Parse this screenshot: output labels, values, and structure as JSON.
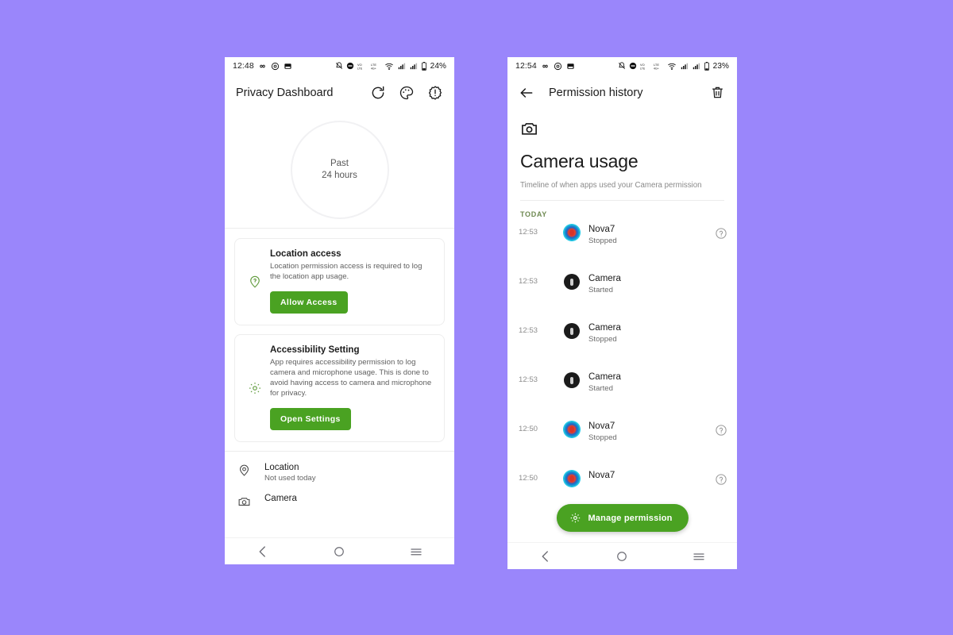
{
  "background_color": "#9a86fb",
  "accent_green": "#4aa222",
  "phones": {
    "left": {
      "status_bar": {
        "clock": "12:48",
        "battery_percent": "24%",
        "left_icons": [
          "infinity-icon",
          "at-circle-icon",
          "screenshot-icon"
        ],
        "right_icons": [
          "notifications-off-icon",
          "do-not-disturb-icon",
          "volte-icon",
          "lte-icon",
          "wifi-icon",
          "signal-bars-icon",
          "signal-bars-icon",
          "battery-icon"
        ]
      },
      "app_bar": {
        "title": "Privacy Dashboard",
        "actions": [
          "refresh-icon",
          "palette-icon",
          "alert-badge-icon"
        ]
      },
      "hero": {
        "line1": "Past",
        "line2": "24 hours"
      },
      "cards": [
        {
          "icon": "location-pin-question-icon",
          "title": "Location access",
          "description": "Location permission access is required to log the location app usage.",
          "button_label": "Allow Access"
        },
        {
          "icon": "accessibility-gear-icon",
          "title": "Accessibility Setting",
          "description": "App requires accessibility permission to log camera and microphone usage. This is done to avoid having access to camera and microphone for privacy.",
          "button_label": "Open Settings"
        }
      ],
      "permissions": [
        {
          "icon": "location-pin-icon",
          "name": "Location",
          "status": "Not used today"
        },
        {
          "icon": "camera-icon",
          "name": "Camera",
          "status": ""
        }
      ],
      "nav_bar": [
        "back-icon",
        "home-icon",
        "recents-icon"
      ]
    },
    "right": {
      "status_bar": {
        "clock": "12:54",
        "battery_percent": "23%",
        "left_icons": [
          "infinity-icon",
          "at-circle-icon",
          "screenshot-icon"
        ],
        "right_icons": [
          "notifications-off-icon",
          "do-not-disturb-icon",
          "volte-icon",
          "lte-icon",
          "wifi-icon",
          "signal-bars-icon",
          "signal-bars-icon",
          "battery-icon"
        ]
      },
      "app_bar": {
        "back_icon": "arrow-back-icon",
        "title": "Permission history",
        "delete_icon": "trash-icon"
      },
      "detail": {
        "icon": "camera-icon",
        "title": "Camera usage",
        "subtitle": "Timeline of when apps used your Camera permission"
      },
      "section_label": "TODAY",
      "timeline": [
        {
          "time": "12:53",
          "avatar": "nova7-app-icon",
          "app": "Nova7",
          "state": "Stopped",
          "help": true
        },
        {
          "time": "12:53",
          "avatar": "camera-app-icon",
          "app": "Camera",
          "state": "Started",
          "help": false
        },
        {
          "time": "12:53",
          "avatar": "camera-app-icon",
          "app": "Camera",
          "state": "Stopped",
          "help": false
        },
        {
          "time": "12:53",
          "avatar": "camera-app-icon",
          "app": "Camera",
          "state": "Started",
          "help": false
        },
        {
          "time": "12:50",
          "avatar": "nova7-app-icon",
          "app": "Nova7",
          "state": "Stopped",
          "help": true
        },
        {
          "time": "12:50",
          "avatar": "nova7-app-icon",
          "app": "Nova7",
          "state": "",
          "help": true
        }
      ],
      "fab": {
        "icon": "gear-icon",
        "label": "Manage permission"
      },
      "nav_bar": [
        "back-icon",
        "home-icon",
        "recents-icon"
      ]
    }
  }
}
